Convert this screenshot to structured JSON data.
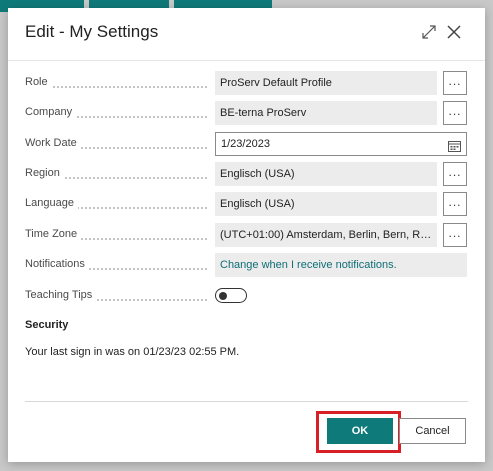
{
  "dialog": {
    "title": "Edit - My Settings"
  },
  "fields": {
    "role": {
      "label": "Role",
      "value": "ProServ Default Profile"
    },
    "company": {
      "label": "Company",
      "value": "BE-terna ProServ"
    },
    "work_date": {
      "label": "Work Date",
      "value": "1/23/2023"
    },
    "region": {
      "label": "Region",
      "value": "Englisch (USA)"
    },
    "language": {
      "label": "Language",
      "value": "Englisch (USA)"
    },
    "time_zone": {
      "label": "Time Zone",
      "value": "(UTC+01:00) Amsterdam, Berlin, Bern, Ro..."
    },
    "notifications": {
      "label": "Notifications",
      "value": "Change when I receive notifications."
    },
    "teaching_tips": {
      "label": "Teaching Tips",
      "enabled": false
    }
  },
  "lookup_glyph": "...",
  "security": {
    "heading": "Security",
    "text": "Your last sign in was on 01/23/23 02:55 PM."
  },
  "buttons": {
    "ok": "OK",
    "cancel": "Cancel"
  },
  "colors": {
    "accent": "#0f7a7a",
    "highlight_outline": "#d71f26",
    "link": "#0f6e76"
  },
  "icons": {
    "expand": "expand-icon",
    "close": "close-icon",
    "calendar": "calendar-icon"
  }
}
